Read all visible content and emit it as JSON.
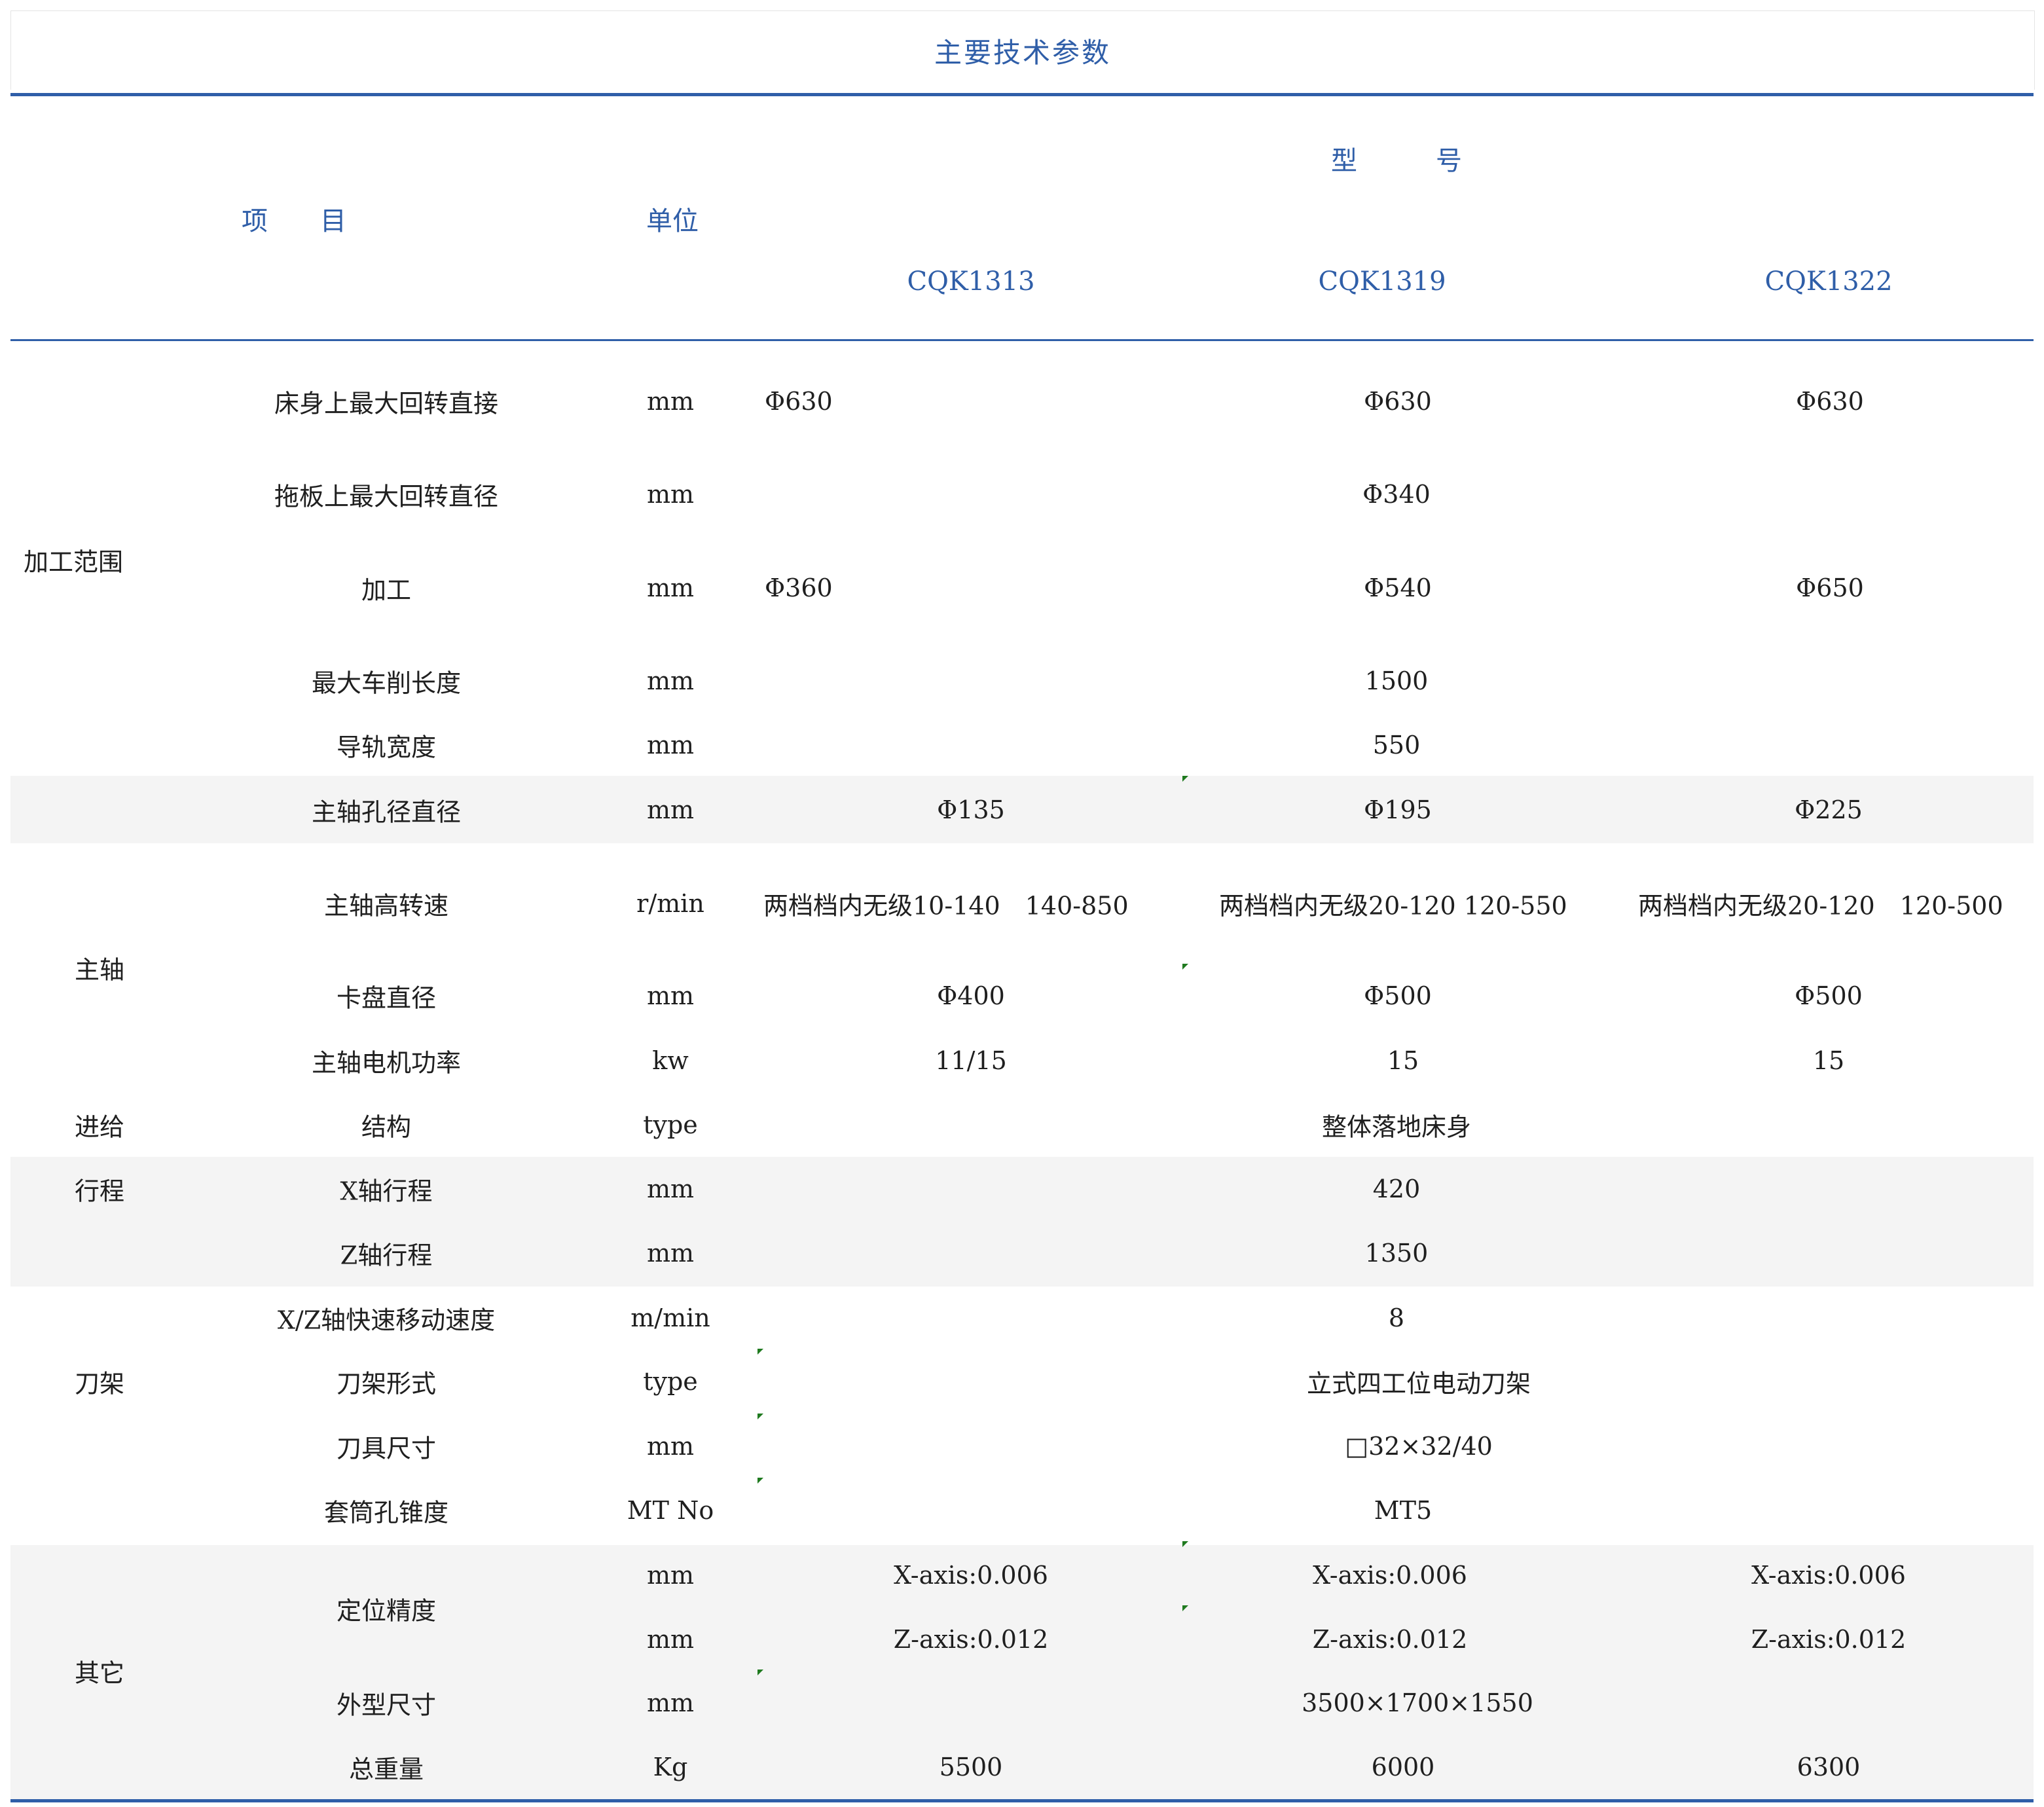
{
  "title": "主要技术参数",
  "header": {
    "item": "项　　目",
    "unit": "单位",
    "model": "型　　　号",
    "models": [
      "CQK1313",
      "CQK1319",
      "CQK1322"
    ]
  },
  "groups": [
    "加工范围",
    "主轴",
    "进给",
    "行程",
    "刀架",
    "其它"
  ],
  "rows": [
    {
      "name": "床身上最大回转直接",
      "unit": "mm",
      "values": [
        "Φ630",
        "Φ630",
        "Φ630"
      ]
    },
    {
      "name": "拖板上最大回转直径",
      "unit": "mm",
      "values": [
        "",
        "Φ340",
        ""
      ]
    },
    {
      "name": "加工",
      "unit": "mm",
      "values": [
        "Φ360",
        "Φ540",
        "Φ650"
      ]
    },
    {
      "name": "最大车削长度",
      "unit": "mm",
      "values": [
        "",
        "1500",
        ""
      ]
    },
    {
      "name": "导轨宽度",
      "unit": "mm",
      "values": [
        "",
        "550",
        ""
      ]
    },
    {
      "name": "主轴孔径直径",
      "unit": "mm",
      "values": [
        "Φ135",
        "Φ195",
        "Φ225"
      ]
    },
    {
      "name": "主轴高转速",
      "unit": "r/min",
      "values": [
        "两档档内无级10-140　140-850",
        "两档档内无级20-120  120-550",
        "两档档内无级20-120　120-500"
      ]
    },
    {
      "name": "卡盘直径",
      "unit": "mm",
      "values": [
        "Φ400",
        "Φ500",
        "Φ500"
      ]
    },
    {
      "name": "主轴电机功率",
      "unit": "kw",
      "values": [
        "11/15",
        "15",
        "15"
      ]
    },
    {
      "name": "结构",
      "unit": "type",
      "values": [
        "",
        "整体落地床身",
        ""
      ]
    },
    {
      "name": "X轴行程",
      "unit": "mm",
      "values": [
        "",
        "420",
        ""
      ]
    },
    {
      "name": "Z轴行程",
      "unit": "mm",
      "values": [
        "",
        "1350",
        ""
      ]
    },
    {
      "name": "X/Z轴快速移动速度",
      "unit": "m/min",
      "values": [
        "",
        "8",
        ""
      ]
    },
    {
      "name": "刀架形式",
      "unit": "type",
      "values": [
        "",
        "立式四工位电动刀架",
        ""
      ]
    },
    {
      "name": "刀具尺寸",
      "unit": "mm",
      "values": [
        "",
        "□32×32/40",
        ""
      ]
    },
    {
      "name": "套筒孔锥度",
      "unit": "MT No",
      "values": [
        "",
        "MT5",
        ""
      ]
    },
    {
      "name": "定位精度",
      "unit": "mm",
      "values": [
        "X-axis:0.006",
        "X-axis:0.006",
        "X-axis:0.006"
      ]
    },
    {
      "name": "",
      "unit": "mm",
      "values": [
        "Z-axis:0.012",
        "Z-axis:0.012",
        "Z-axis:0.012"
      ]
    },
    {
      "name": "外型尺寸",
      "unit": "mm",
      "values": [
        "",
        "3500×1700×1550",
        ""
      ]
    },
    {
      "name": "总重量",
      "unit": "Kg",
      "values": [
        "5500",
        "6000",
        "6300"
      ]
    }
  ],
  "colors": {
    "accent": "#2f5ea8",
    "band": "#f4f4f4",
    "mark": "#1f7a1f"
  }
}
